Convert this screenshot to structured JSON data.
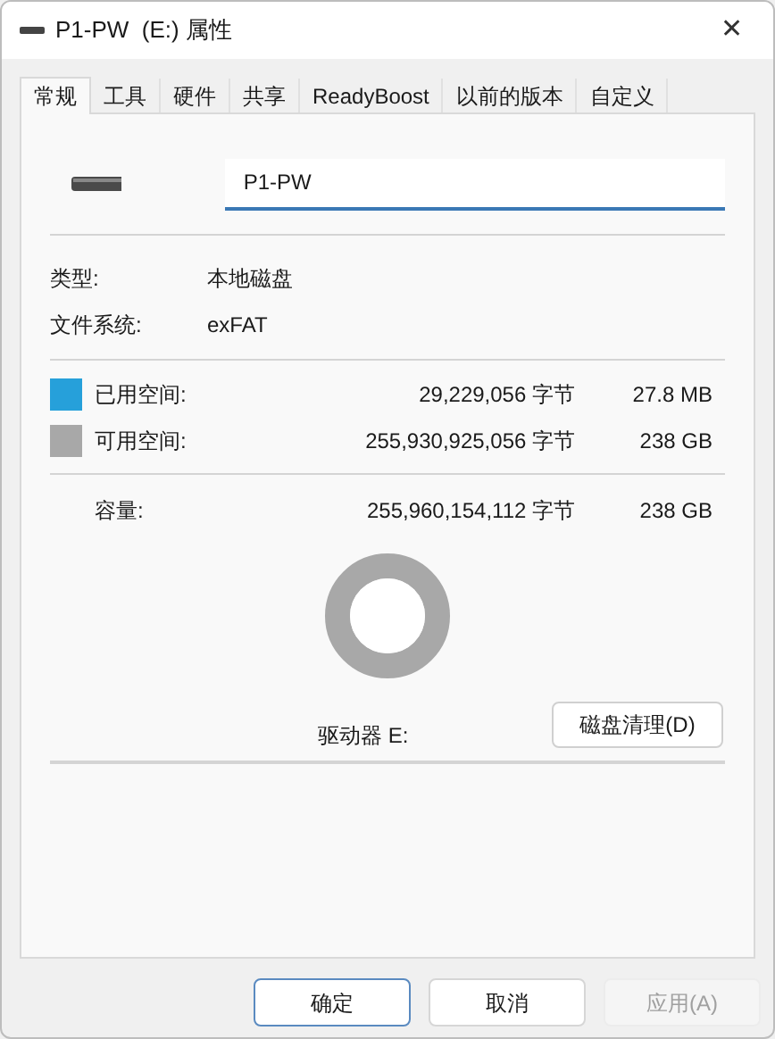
{
  "window": {
    "title": "P1-PW  (E:) 属性",
    "close": "✕"
  },
  "tabs": [
    {
      "label": "常规",
      "selected": true
    },
    {
      "label": "工具",
      "selected": false
    },
    {
      "label": "硬件",
      "selected": false
    },
    {
      "label": "共享",
      "selected": false
    },
    {
      "label": "ReadyBoost",
      "selected": false
    },
    {
      "label": "以前的版本",
      "selected": false
    },
    {
      "label": "自定义",
      "selected": false
    }
  ],
  "name_field": {
    "value": "P1-PW"
  },
  "info": [
    {
      "label": "类型:",
      "value": "本地磁盘"
    },
    {
      "label": "文件系统:",
      "value": "exFAT"
    }
  ],
  "space": [
    {
      "label": "已用空间:",
      "bytes": "29,229,056 字节",
      "size": "27.8 MB",
      "color": "#26a0da"
    },
    {
      "label": "可用空间:",
      "bytes": "255,930,925,056 字节",
      "size": "238 GB",
      "color": "#a8a8a8"
    }
  ],
  "capacity": {
    "label": "容量:",
    "bytes": "255,960,154,112 字节",
    "size": "238 GB"
  },
  "drive_label": "驱动器 E:",
  "cleanup_button": "磁盘清理(D)",
  "buttons": [
    {
      "label": "确定",
      "default": true,
      "disabled": false
    },
    {
      "label": "取消",
      "default": false,
      "disabled": false
    },
    {
      "label": "应用(A)",
      "default": false,
      "disabled": true
    }
  ]
}
